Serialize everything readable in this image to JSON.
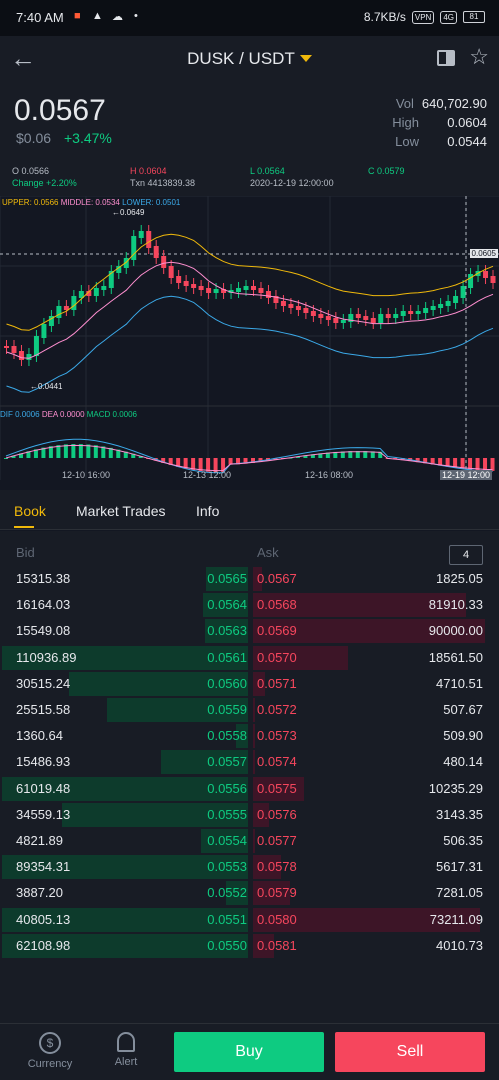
{
  "status": {
    "time": "7:40 AM",
    "speed": "8.7KB/s",
    "vpn": "VPN",
    "network": "4G",
    "battery": "81"
  },
  "header": {
    "pair": "DUSK / USDT"
  },
  "price": {
    "last": "0.0567",
    "usd": "$0.06",
    "change": "+3.47%"
  },
  "stats": {
    "vol_label": "Vol",
    "vol": "640,702.90",
    "high_label": "High",
    "high": "0.0604",
    "low_label": "Low",
    "low": "0.0544"
  },
  "ohlc": {
    "open": "O 0.0566",
    "high": "H 0.0604",
    "low": "L 0.0564",
    "close": "C 0.0579",
    "change": "Change +2.20%",
    "txn": "Txn 4413839.38",
    "date": "2020-12-19 12:00:00"
  },
  "indicators": {
    "upper": "UPPER: 0.0566",
    "middle": "MIDDLE: 0.0534",
    "lower": "LOWER: 0.0501",
    "dif": "DIF 0.0006",
    "dea": "DEA 0.0000",
    "macd": "MACD 0.0006",
    "max_marker": "0.0649",
    "min_marker": "0.0441",
    "cursor_price": "0.0605"
  },
  "chart_dates": [
    "12-10 16:00",
    "12-13 12:00",
    "12-16 08:00",
    "12-19 12:00"
  ],
  "colors": {
    "up": "#0ecb81",
    "down": "#f6465d",
    "accent": "#f0b90b",
    "upper_line": "#f0b90b",
    "middle_line": "#ff8fd0",
    "lower_line": "#3ba9e8"
  },
  "tabs": [
    "Book",
    "Market Trades",
    "Info"
  ],
  "book": {
    "bid_header": "Bid",
    "ask_header": "Ask",
    "depth": "4",
    "rows": [
      {
        "bq": "15315.38",
        "bp": "0.0565",
        "ap": "0.0567",
        "aq": "1825.05",
        "bw": 0.17,
        "aw": 0.04
      },
      {
        "bq": "16164.03",
        "bp": "0.0564",
        "ap": "0.0568",
        "aq": "81910.33",
        "bw": 0.18,
        "aw": 0.92
      },
      {
        "bq": "15549.08",
        "bp": "0.0563",
        "ap": "0.0569",
        "aq": "90000.00",
        "bw": 0.175,
        "aw": 1.0
      },
      {
        "bq": "110936.89",
        "bp": "0.0561",
        "ap": "0.0570",
        "aq": "18561.50",
        "bw": 0.99,
        "aw": 0.41
      },
      {
        "bq": "30515.24",
        "bp": "0.0560",
        "ap": "0.0571",
        "aq": "4710.51",
        "bw": 0.72,
        "aw": 0.05
      },
      {
        "bq": "25515.58",
        "bp": "0.0559",
        "ap": "0.0572",
        "aq": "507.67",
        "bw": 0.57,
        "aw": 0.01
      },
      {
        "bq": "1360.64",
        "bp": "0.0558",
        "ap": "0.0573",
        "aq": "509.90",
        "bw": 0.05,
        "aw": 0.01
      },
      {
        "bq": "15486.93",
        "bp": "0.0557",
        "ap": "0.0574",
        "aq": "480.14",
        "bw": 0.35,
        "aw": 0.01
      },
      {
        "bq": "61019.48",
        "bp": "0.0556",
        "ap": "0.0575",
        "aq": "10235.29",
        "bw": 0.99,
        "aw": 0.22
      },
      {
        "bq": "34559.13",
        "bp": "0.0555",
        "ap": "0.0576",
        "aq": "3143.35",
        "bw": 0.75,
        "aw": 0.07
      },
      {
        "bq": "4821.89",
        "bp": "0.0554",
        "ap": "0.0577",
        "aq": "506.35",
        "bw": 0.19,
        "aw": 0.01
      },
      {
        "bq": "89354.31",
        "bp": "0.0553",
        "ap": "0.0578",
        "aq": "5617.31",
        "bw": 0.99,
        "aw": 0.12
      },
      {
        "bq": "3887.20",
        "bp": "0.0552",
        "ap": "0.0579",
        "aq": "7281.05",
        "bw": 0.09,
        "aw": 0.16
      },
      {
        "bq": "40805.13",
        "bp": "0.0551",
        "ap": "0.0580",
        "aq": "73211.09",
        "bw": 0.99,
        "aw": 0.98
      },
      {
        "bq": "62108.98",
        "bp": "0.0550",
        "ap": "0.0581",
        "aq": "4010.73",
        "bw": 0.99,
        "aw": 0.09
      }
    ]
  },
  "bottom": {
    "currency": "Currency",
    "currency_symbol": "$",
    "alert": "Alert",
    "buy": "Buy",
    "sell": "Sell"
  }
}
